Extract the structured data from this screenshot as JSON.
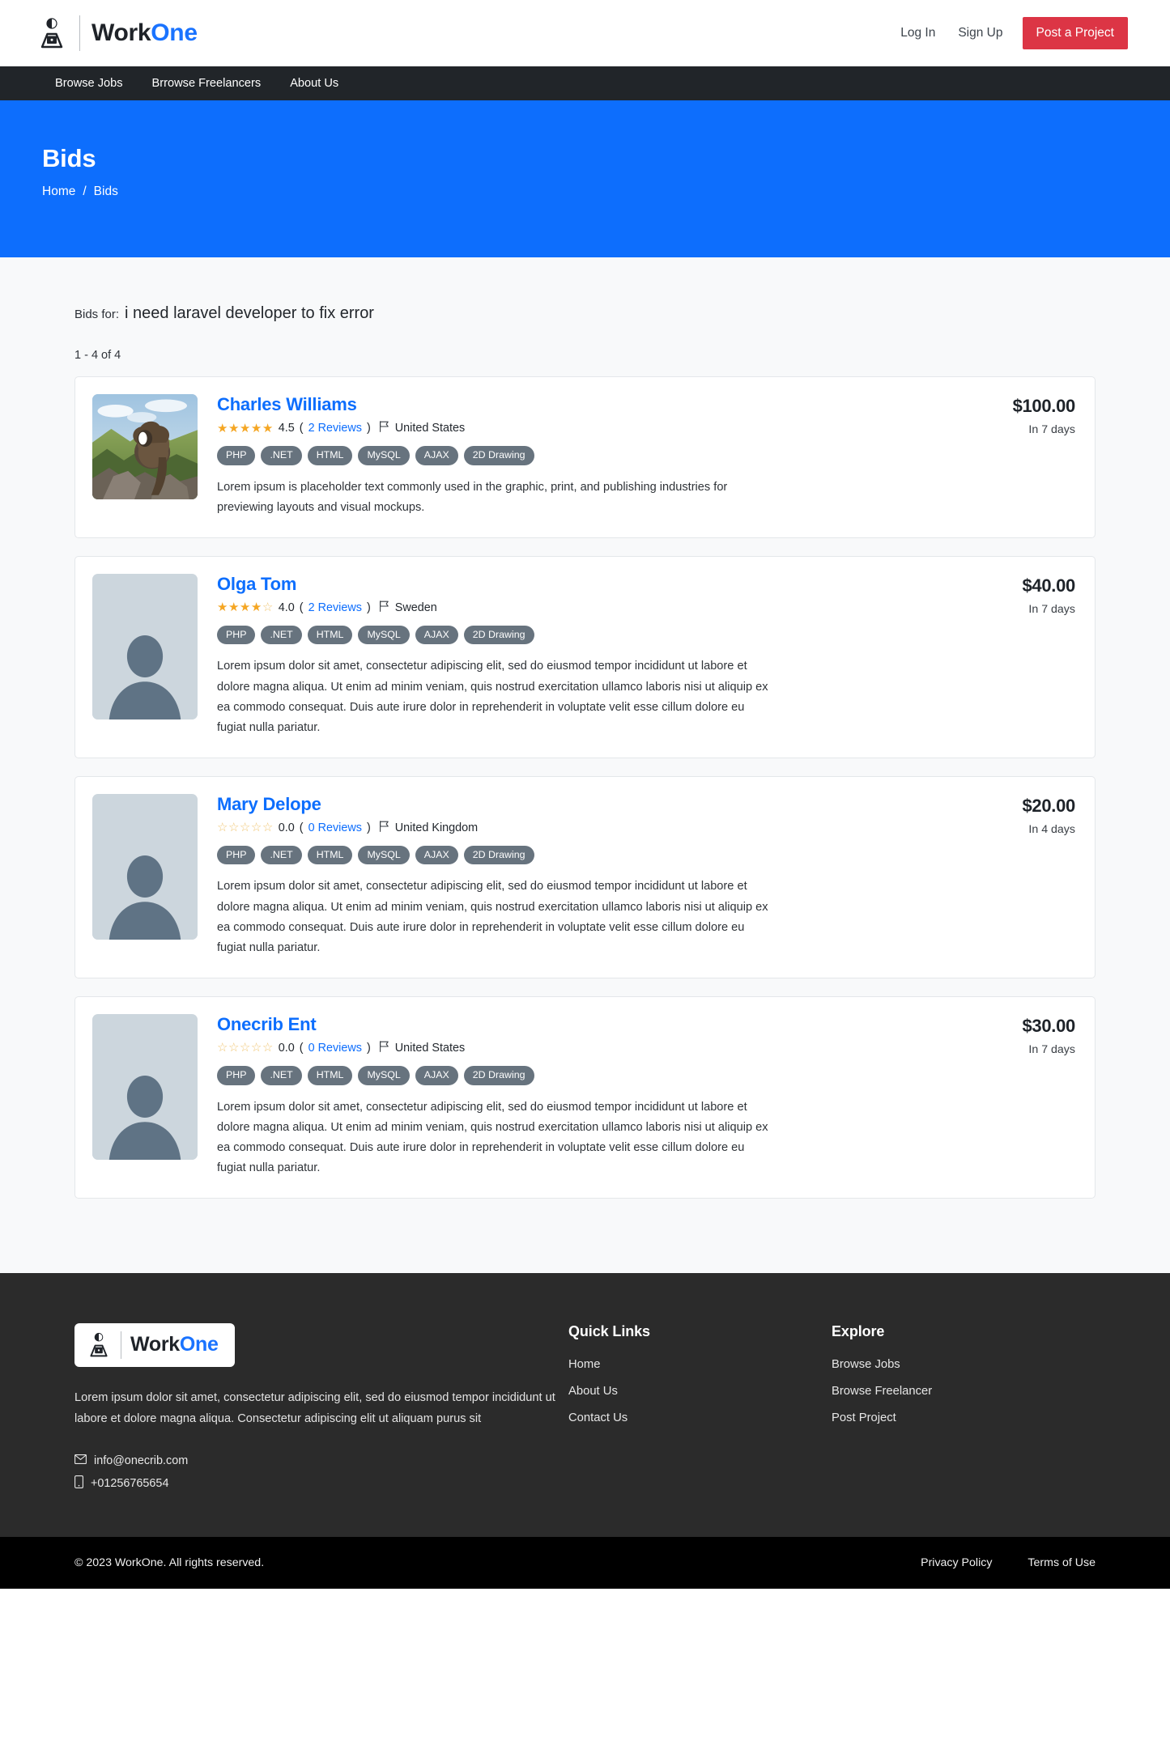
{
  "header": {
    "brand": {
      "part1": "Work",
      "part2": "One",
      "icon": "person-laptop-icon"
    },
    "login_label": "Log In",
    "signup_label": "Sign Up",
    "post_project_label": "Post a Project",
    "accent_red": "#dc3545"
  },
  "nav": {
    "items": [
      {
        "label": "Browse Jobs"
      },
      {
        "label": "Brrowse Freelancers"
      },
      {
        "label": "About Us"
      }
    ]
  },
  "banner": {
    "title": "Bids",
    "breadcrumb_home": "Home",
    "breadcrumb_sep": "/",
    "breadcrumb_current": "Bids",
    "background": "#0d6efd"
  },
  "main": {
    "bids_for_label": "Bids for:",
    "bids_for_title": "i need laravel developer to fix error",
    "result_count": "1 - 4 of 4",
    "bids": [
      {
        "name": "Charles Williams",
        "avatar_type": "photo-lion",
        "stars_filled": 5,
        "stars_empty": 0,
        "rating": "4.5",
        "reviews": "2 Reviews",
        "country": "United States",
        "tags": [
          "PHP",
          ".NET",
          "HTML",
          "MySQL",
          "AJAX",
          "2D Drawing"
        ],
        "description": "Lorem ipsum is placeholder text commonly used in the graphic, print, and publishing industries for previewing layouts and visual mockups.",
        "price": "$100.00",
        "delivery": "In 7 days"
      },
      {
        "name": "Olga Tom",
        "avatar_type": "placeholder",
        "stars_filled": 4,
        "stars_empty": 1,
        "rating": "4.0",
        "reviews": "2 Reviews",
        "country": "Sweden",
        "tags": [
          "PHP",
          ".NET",
          "HTML",
          "MySQL",
          "AJAX",
          "2D Drawing"
        ],
        "description": "Lorem ipsum dolor sit amet, consectetur adipiscing elit, sed do eiusmod tempor incididunt ut labore et dolore magna aliqua. Ut enim ad minim veniam, quis nostrud exercitation ullamco laboris nisi ut aliquip ex ea commodo consequat. Duis aute irure dolor in reprehenderit in voluptate velit esse cillum dolore eu fugiat nulla pariatur.",
        "price": "$40.00",
        "delivery": "In 7 days"
      },
      {
        "name": "Mary Delope",
        "avatar_type": "placeholder",
        "stars_filled": 0,
        "stars_empty": 5,
        "rating": "0.0",
        "reviews": "0 Reviews",
        "country": "United Kingdom",
        "tags": [
          "PHP",
          ".NET",
          "HTML",
          "MySQL",
          "AJAX",
          "2D Drawing"
        ],
        "description": "Lorem ipsum dolor sit amet, consectetur adipiscing elit, sed do eiusmod tempor incididunt ut labore et dolore magna aliqua. Ut enim ad minim veniam, quis nostrud exercitation ullamco laboris nisi ut aliquip ex ea commodo consequat. Duis aute irure dolor in reprehenderit in voluptate velit esse cillum dolore eu fugiat nulla pariatur.",
        "price": "$20.00",
        "delivery": "In 4 days"
      },
      {
        "name": "Onecrib Ent",
        "avatar_type": "placeholder",
        "stars_filled": 0,
        "stars_empty": 5,
        "rating": "0.0",
        "reviews": "0 Reviews",
        "country": "United States",
        "tags": [
          "PHP",
          ".NET",
          "HTML",
          "MySQL",
          "AJAX",
          "2D Drawing"
        ],
        "description": "Lorem ipsum dolor sit amet, consectetur adipiscing elit, sed do eiusmod tempor incididunt ut labore et dolore magna aliqua. Ut enim ad minim veniam, quis nostrud exercitation ullamco laboris nisi ut aliquip ex ea commodo consequat. Duis aute irure dolor in reprehenderit in voluptate velit esse cillum dolore eu fugiat nulla pariatur.",
        "price": "$30.00",
        "delivery": "In 7 days"
      }
    ]
  },
  "footer": {
    "brand": {
      "part1": "Work",
      "part2": "One"
    },
    "description": "Lorem ipsum dolor sit amet, consectetur adipiscing elit, sed do eiusmod tempor incididunt ut labore et dolore magna aliqua. Consectetur adipiscing elit ut aliquam purus sit",
    "email": "info@onecrib.com",
    "phone": "+01256765654",
    "columns": [
      {
        "heading": "Quick Links",
        "links": [
          "Home",
          "About Us",
          "Contact Us"
        ]
      },
      {
        "heading": "Explore",
        "links": [
          "Browse Jobs",
          "Browse Freelancer",
          "Post Project"
        ]
      }
    ],
    "copyright": "© 2023 WorkOne. All rights reserved.",
    "legal": [
      "Privacy Policy",
      "Terms of Use"
    ]
  }
}
